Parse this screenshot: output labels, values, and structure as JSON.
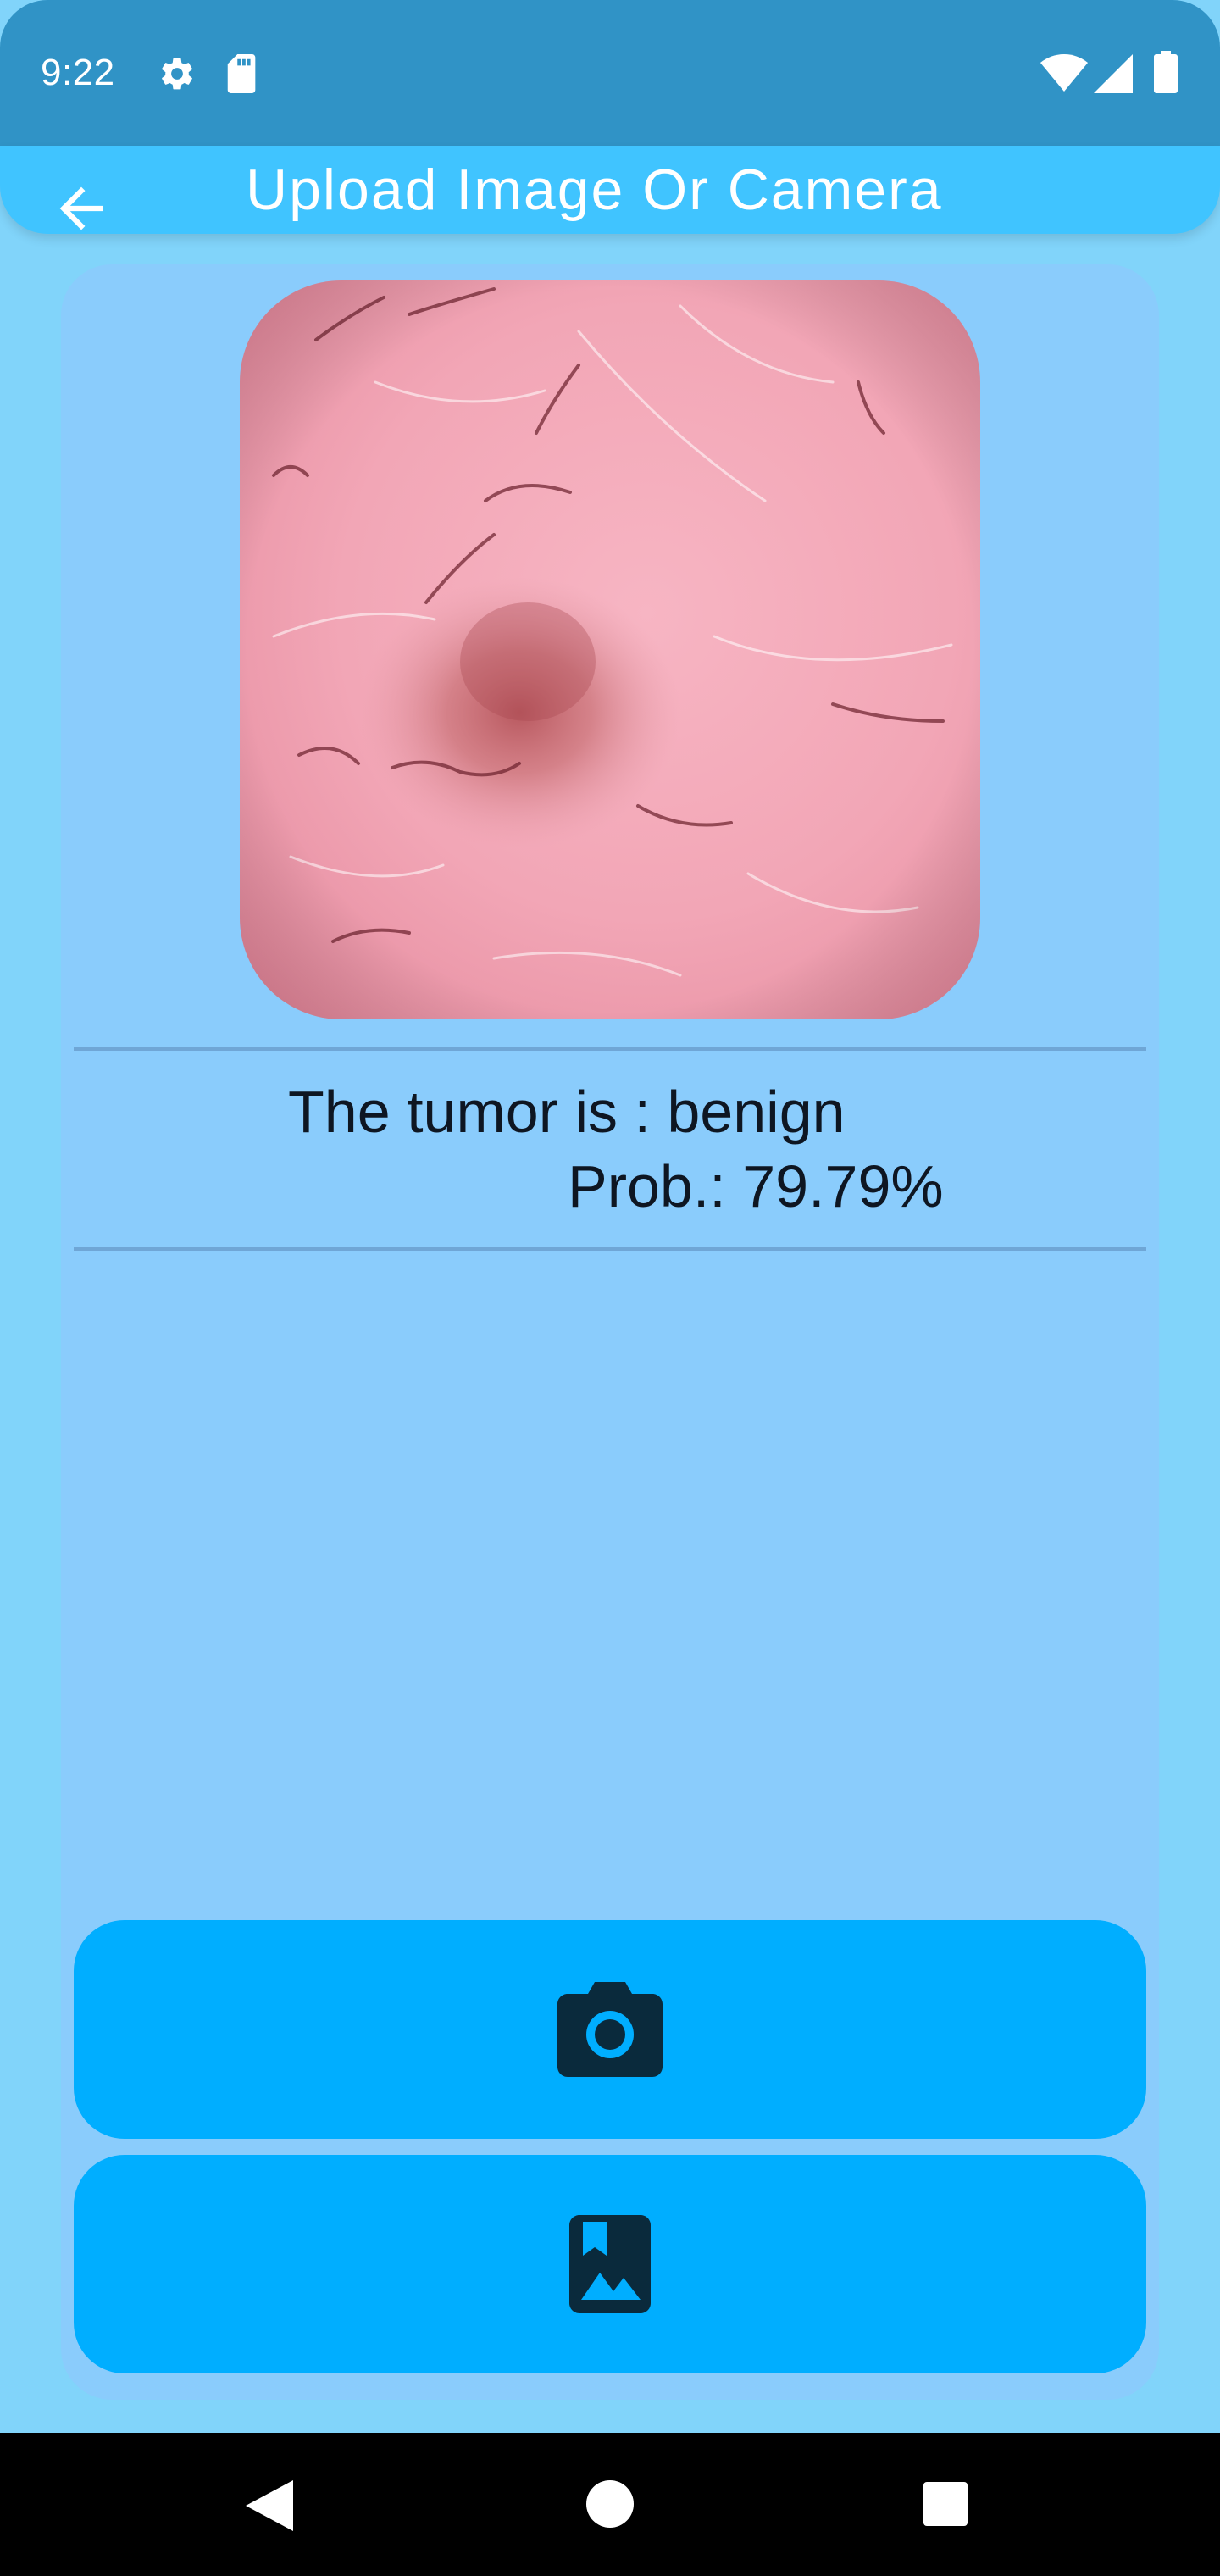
{
  "status_bar": {
    "time": "9:22",
    "icons": [
      "gear-icon",
      "sd-card-icon",
      "wifi-icon",
      "cell-signal-icon",
      "battery-icon"
    ],
    "background_color": "#3093C6"
  },
  "app_bar": {
    "title": "Upload Image Or Camera",
    "back_icon": "arrow-back-icon",
    "background_color": "#40C4FF"
  },
  "preview": {
    "icon": "skin-lesion-image"
  },
  "result": {
    "label": "The tumor is : benign",
    "probability": "Prob.: 79.79%"
  },
  "actions": {
    "camera_icon": "camera-icon",
    "gallery_icon": "photo-album-icon",
    "button_color": "#00AEFF",
    "icon_color": "#0A2A3C"
  },
  "colors": {
    "page_background": "#81D4FA",
    "card_background": "#8ACCFC"
  },
  "nav_bar": {
    "icons": [
      "nav-back-icon",
      "nav-home-icon",
      "nav-recents-icon"
    ]
  }
}
